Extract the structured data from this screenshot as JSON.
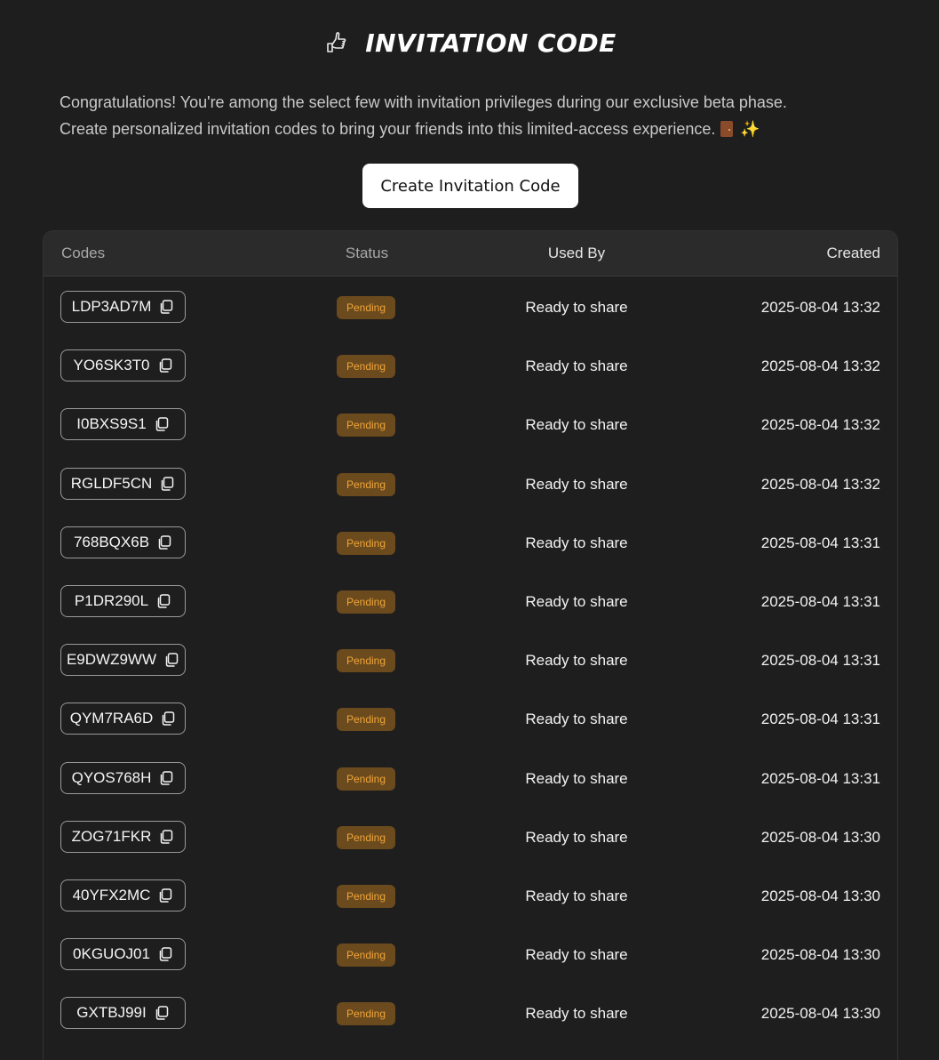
{
  "header": {
    "title": "INVITATION CODE",
    "title_icon": "pointing-hand-icon"
  },
  "intro": {
    "line1": "Congratulations! You're among the select few with invitation privileges during our exclusive beta phase.",
    "line2": "Create personalized invitation codes to bring your friends into this limited-access experience.",
    "emoji_1": "door-icon",
    "emoji_2": "sparkles-icon"
  },
  "actions": {
    "create_label": "Create Invitation Code"
  },
  "table": {
    "headers": {
      "codes": "Codes",
      "status": "Status",
      "used_by": "Used By",
      "created": "Created"
    },
    "rows": [
      {
        "code": "LDP3AD7M",
        "status": "Pending",
        "used_by": "Ready to share",
        "created": "2025-08-04 13:32"
      },
      {
        "code": "YO6SK3T0",
        "status": "Pending",
        "used_by": "Ready to share",
        "created": "2025-08-04 13:32"
      },
      {
        "code": "I0BXS9S1",
        "status": "Pending",
        "used_by": "Ready to share",
        "created": "2025-08-04 13:32"
      },
      {
        "code": "RGLDF5CN",
        "status": "Pending",
        "used_by": "Ready to share",
        "created": "2025-08-04 13:32"
      },
      {
        "code": "768BQX6B",
        "status": "Pending",
        "used_by": "Ready to share",
        "created": "2025-08-04 13:31"
      },
      {
        "code": "P1DR290L",
        "status": "Pending",
        "used_by": "Ready to share",
        "created": "2025-08-04 13:31"
      },
      {
        "code": "E9DWZ9WW",
        "status": "Pending",
        "used_by": "Ready to share",
        "created": "2025-08-04 13:31"
      },
      {
        "code": "QYM7RA6D",
        "status": "Pending",
        "used_by": "Ready to share",
        "created": "2025-08-04 13:31"
      },
      {
        "code": "QYOS768H",
        "status": "Pending",
        "used_by": "Ready to share",
        "created": "2025-08-04 13:31"
      },
      {
        "code": "ZOG71FKR",
        "status": "Pending",
        "used_by": "Ready to share",
        "created": "2025-08-04 13:30"
      },
      {
        "code": "40YFX2MC",
        "status": "Pending",
        "used_by": "Ready to share",
        "created": "2025-08-04 13:30"
      },
      {
        "code": "0KGUOJ01",
        "status": "Pending",
        "used_by": "Ready to share",
        "created": "2025-08-04 13:30"
      },
      {
        "code": "GXTBJ99I",
        "status": "Pending",
        "used_by": "Ready to share",
        "created": "2025-08-04 13:30"
      }
    ]
  },
  "colors": {
    "background": "#1e1e1e",
    "header_bg": "#2b2b2b",
    "badge_bg": "#6b4a1d",
    "badge_text": "#f0a53a",
    "button_bg": "#ffffff"
  }
}
